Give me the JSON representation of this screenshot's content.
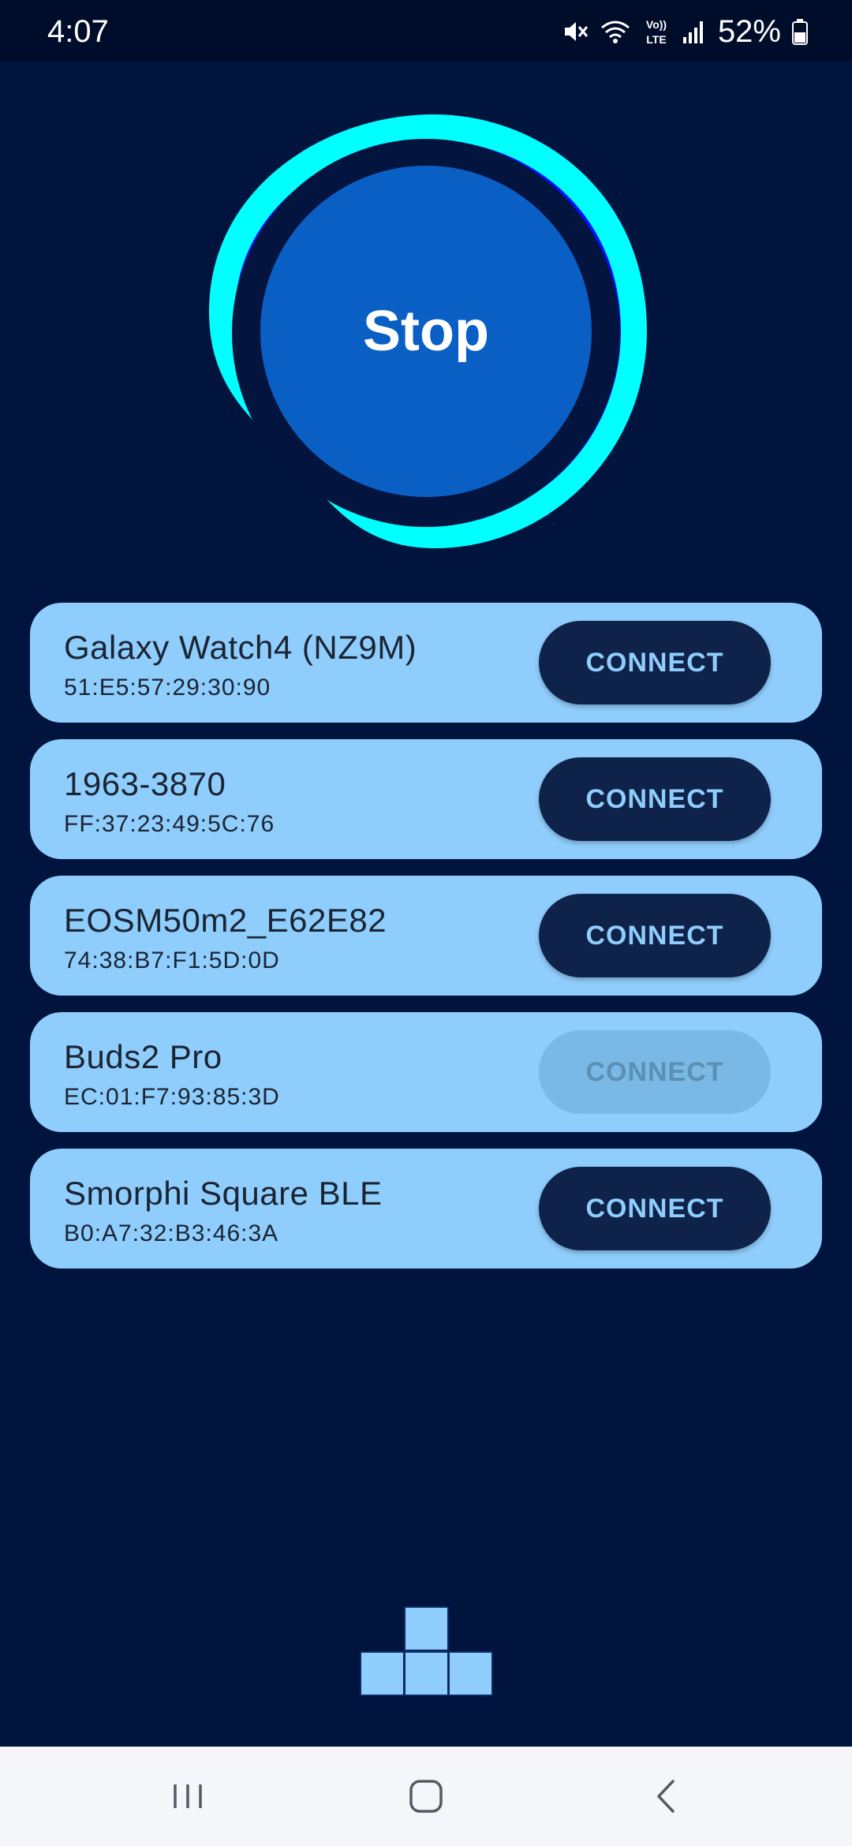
{
  "status_bar": {
    "time": "4:07",
    "battery": "52%",
    "icons": [
      "mute-icon",
      "wifi-icon",
      "volte-icon",
      "signal-icon",
      "battery-icon"
    ]
  },
  "scan": {
    "label": "Stop"
  },
  "devices": [
    {
      "name": "Galaxy Watch4 (NZ9M)",
      "address": "51:E5:57:29:30:90",
      "action": "CONNECT",
      "enabled": true
    },
    {
      "name": "1963-3870",
      "address": "FF:37:23:49:5C:76",
      "action": "CONNECT",
      "enabled": true
    },
    {
      "name": "EOSM50m2_E62E82",
      "address": "74:38:B7:F1:5D:0D",
      "action": "CONNECT",
      "enabled": true
    },
    {
      "name": "Buds2 Pro",
      "address": "EC:01:F7:93:85:3D",
      "action": "CONNECT",
      "enabled": false
    },
    {
      "name": "Smorphi Square BLE",
      "address": "B0:A7:32:B3:46:3A",
      "action": "CONNECT",
      "enabled": true
    }
  ],
  "colors": {
    "background": "#00143d",
    "card": "#8fcdfc",
    "button": "#0f2249",
    "ring_outer": "#00ffff",
    "ring_inner": "#0000ff",
    "scan_button": "#0a5fc4"
  },
  "nav_bar": {
    "icons": [
      "recent-apps-icon",
      "home-icon",
      "back-icon"
    ]
  }
}
